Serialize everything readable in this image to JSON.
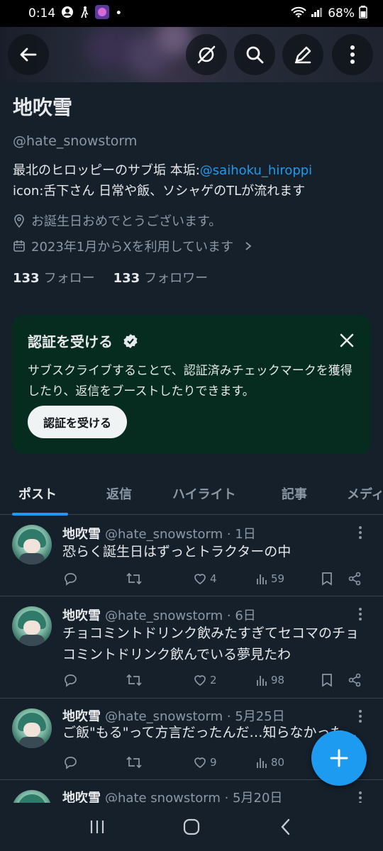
{
  "status": {
    "time": "0:14",
    "battery": "68%"
  },
  "profile": {
    "name": "地吹雪",
    "handle": "@hate_snowstorm",
    "bio_prefix": "最北のヒロッピーのサブ垢 本垢:",
    "bio_link": "@saihoku_hiroppi",
    "bio_line2": "icon:舌下さん 日常や飯、ソシャゲのTLが流れます",
    "location": "お誕生日おめでとうございます。",
    "joined": "2023年1月からXを利用しています",
    "following_count": "133",
    "following_label": "フォロー",
    "followers_count": "133",
    "followers_label": "フォロワー"
  },
  "verify": {
    "title": "認証を受ける",
    "desc": "サブスクライブすることで、認証済みチェックマークを獲得したり、返信をブーストしたりできます。",
    "button": "認証を受ける"
  },
  "tabs": [
    "ポスト",
    "返信",
    "ハイライト",
    "記事",
    "メディ"
  ],
  "posts": [
    {
      "name": "地吹雪",
      "meta": "@hate_snowstorm · 1日",
      "text": "恐らく誕生日はずっとトラクターの中",
      "likes": "4",
      "views": "59"
    },
    {
      "name": "地吹雪",
      "meta": "@hate_snowstorm · 6日",
      "text": "チョコミントドリンク飲みたすぎてセコマのチョコミントドリンク飲んでいる夢見たわ",
      "likes": "2",
      "views": "98"
    },
    {
      "name": "地吹雪",
      "meta": "@hate_snowstorm · 5月25日",
      "text": "ご飯\"もる\"って方言だったんだ…知らなかった…",
      "likes": "9",
      "views": "80"
    },
    {
      "name": "地吹雪",
      "meta": "@hate snowstorm · 5月20日",
      "text": "",
      "likes": "",
      "views": ""
    }
  ],
  "colors": {
    "accent": "#1d9bf0",
    "background": "#15202b",
    "verify_bg": "#062b1f"
  }
}
